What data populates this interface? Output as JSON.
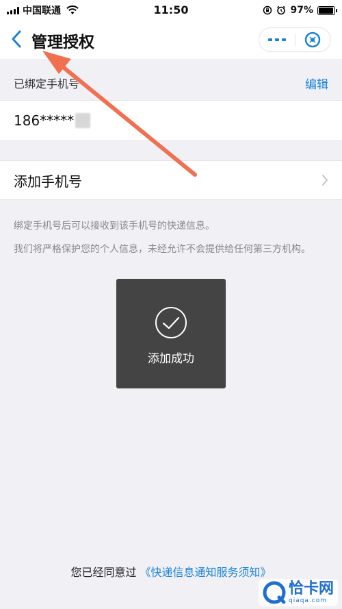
{
  "status_bar": {
    "carrier": "中国联通",
    "time": "11:50",
    "battery_text": "97%",
    "battery_level": 0.97,
    "icons": [
      "signal-icon",
      "wifi-icon",
      "orientation-lock-icon",
      "alarm-icon",
      "battery-icon"
    ]
  },
  "nav": {
    "title": "管理授权",
    "back_icon": "chevron-left-icon",
    "more_icon": "more-icon",
    "close_icon": "close-circle-icon"
  },
  "bound_section": {
    "header": "已绑定手机号",
    "edit_label": "编辑",
    "phone": "186*****"
  },
  "add_row": {
    "label": "添加手机号",
    "chevron_icon": "chevron-right-icon"
  },
  "notes": {
    "line1": "绑定手机号后可以接收到该手机号的快递信息。",
    "line2": "我们将严格保护您的个人信息，未经允许不会提供给任何第三方机构。"
  },
  "toast": {
    "message": "添加成功",
    "icon": "checkmark-icon"
  },
  "footer": {
    "prefix": "您已经同意过",
    "link": "《快递信息通知服务须知》"
  },
  "watermark": {
    "name": "恰卡网",
    "url": "qiaqa.com"
  },
  "colors": {
    "accent": "#1a82d8",
    "annotation_arrow": "#f07050",
    "toast_bg": "#3c3c3c",
    "background": "#f1f1f5"
  }
}
